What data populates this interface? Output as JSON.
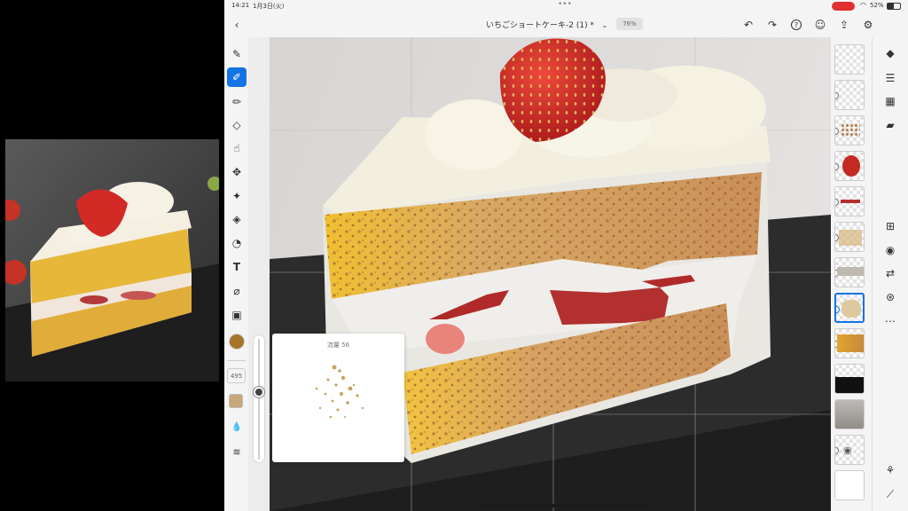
{
  "status_bar": {
    "time": "14:21",
    "date": "1月3日(火)",
    "battery": "52%",
    "multitask_dots": "•••"
  },
  "topbar": {
    "back_icon": "chevron-left-icon",
    "document_title": "いちごショートケーキ-2 (1) *",
    "title_dropdown_icon": "chevron-down-icon",
    "zoom": "76%",
    "icons": [
      "undo-icon",
      "redo-icon",
      "help-icon",
      "invite-user-icon",
      "share-icon",
      "settings-gear-icon"
    ]
  },
  "tools": [
    "paintbrush-icon",
    "pencil-brush-icon",
    "pixel-brush-icon",
    "eraser-icon",
    "smudge-icon",
    "move-icon",
    "magic-wand-icon",
    "fill-icon",
    "shape-icon",
    "text-icon",
    "eyedropper-icon",
    "image-icon"
  ],
  "tool_panel": {
    "brush_size": "495",
    "color_hex": "#a8742a",
    "secondary_swatch": "#c8a77a"
  },
  "brush_popup": {
    "label": "流量 56"
  },
  "layers_count": 13,
  "right_panel_icons": [
    "layers-icon",
    "properties-icon",
    "grid-icon",
    "comment-icon",
    "add-layer-icon",
    "visibility-eye-icon",
    "transform-icon",
    "mask-icon",
    "more-icon",
    "settings-icon",
    "ruler-icon"
  ],
  "colors": {
    "accent": "#1473e6",
    "status_record": "#e03030"
  }
}
